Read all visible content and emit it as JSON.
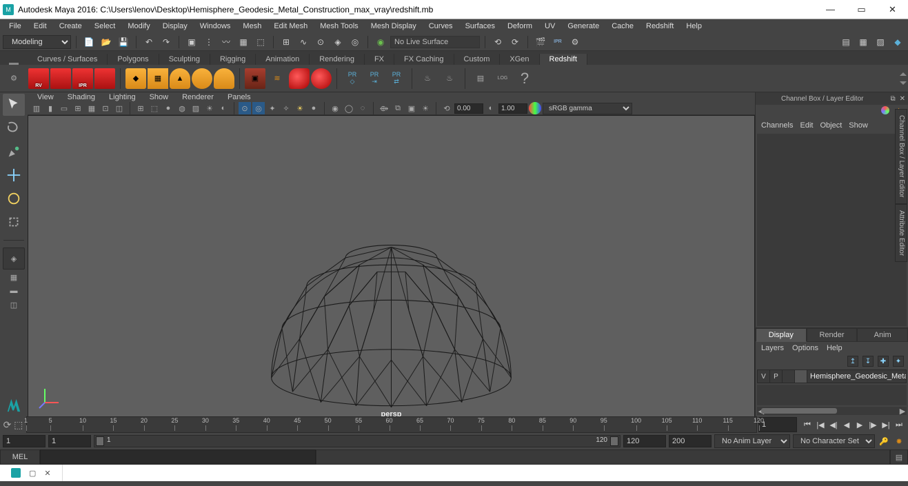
{
  "window": {
    "title": "Autodesk Maya 2016: C:\\Users\\lenov\\Desktop\\Hemisphere_Geodesic_Metal_Construction_max_vray\\redshift.mb",
    "minimize": "—",
    "maximize": "▭",
    "close": "✕"
  },
  "menubar": [
    "File",
    "Edit",
    "Create",
    "Select",
    "Modify",
    "Display",
    "Windows",
    "Mesh",
    "Edit Mesh",
    "Mesh Tools",
    "Mesh Display",
    "Curves",
    "Surfaces",
    "Deform",
    "UV",
    "Generate",
    "Cache",
    "Redshift",
    "Help"
  ],
  "workspace": "Modeling",
  "no_live_surface": "No Live Surface",
  "shelf_tabs": [
    "Curves / Surfaces",
    "Polygons",
    "Sculpting",
    "Rigging",
    "Animation",
    "Rendering",
    "FX",
    "FX Caching",
    "Custom",
    "XGen",
    "Redshift"
  ],
  "shelf_active": 10,
  "shelf_red_labels": [
    "RV",
    "",
    "IPR",
    ""
  ],
  "shelf_pr_labels": [
    "PR",
    "PR",
    "PR"
  ],
  "panel_menu": [
    "View",
    "Shading",
    "Lighting",
    "Show",
    "Renderer",
    "Panels"
  ],
  "panel_toolbar": {
    "val1": "0.00",
    "val2": "1.00",
    "color_space": "sRGB gamma"
  },
  "viewport": {
    "camera": "persp"
  },
  "channelbox": {
    "title": "Channel Box / Layer Editor",
    "tabs": [
      "Channels",
      "Edit",
      "Object",
      "Show"
    ]
  },
  "layers": {
    "tabs": [
      "Display",
      "Render",
      "Anim"
    ],
    "active": 0,
    "menu": [
      "Layers",
      "Options",
      "Help"
    ],
    "row": {
      "v": "V",
      "p": "P",
      "name": "Hemisphere_Geodesic_Meta"
    }
  },
  "side_tabs": [
    "Channel Box / Layer Editor",
    "Attribute Editor"
  ],
  "time": {
    "ruler_ticks": [
      1,
      5,
      10,
      15,
      20,
      25,
      30,
      35,
      40,
      45,
      50,
      55,
      60,
      65,
      70,
      75,
      80,
      85,
      90,
      95,
      100,
      105,
      110,
      115,
      120
    ],
    "current": "1",
    "range_start": "1",
    "range_inStart": "1",
    "range_inEnd": "120",
    "range_outEnd": "120",
    "range_end": "200",
    "anim_layer": "No Anim Layer",
    "character": "No Character Set"
  },
  "cmd": {
    "label": "MEL"
  }
}
